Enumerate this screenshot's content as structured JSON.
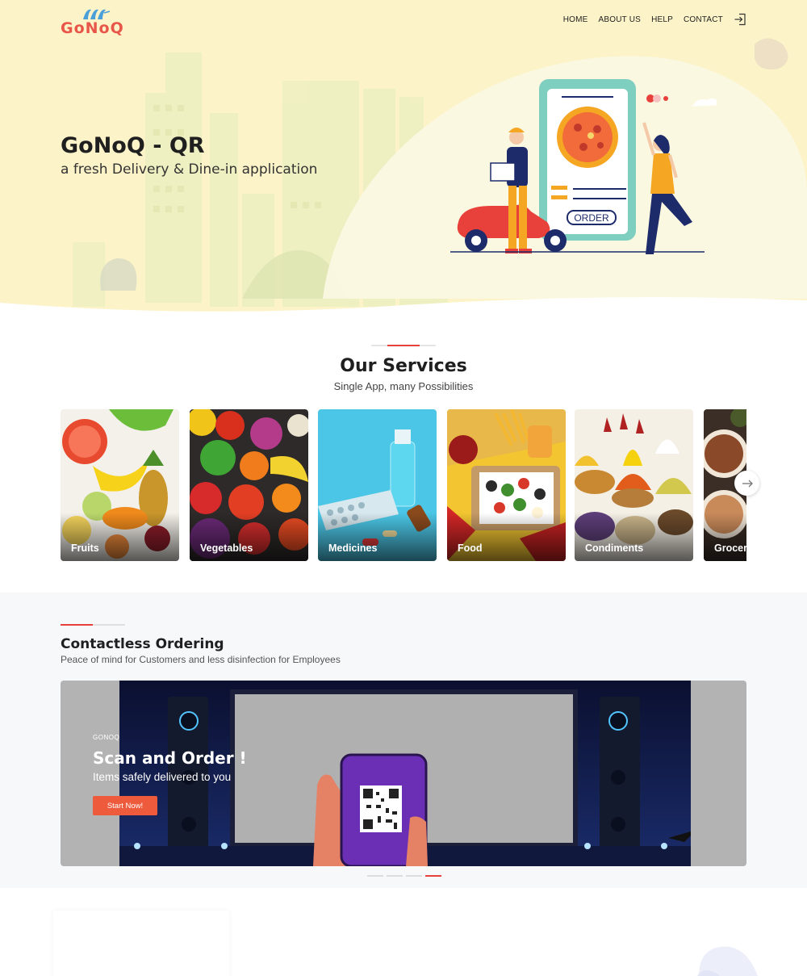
{
  "header": {
    "logo_text": "GoNoQ",
    "nav": [
      "HOME",
      "ABOUT US",
      "HELP",
      "CONTACT"
    ],
    "login_icon": "login-icon"
  },
  "hero": {
    "title": "GoNoQ - QR",
    "subtitle": "a fresh Delivery & Dine-in application",
    "order_label": "ORDER"
  },
  "services": {
    "title": "Our Services",
    "subtitle": "Single App, many Possibilities",
    "cards": [
      {
        "label": "Fruits"
      },
      {
        "label": "Vegetables"
      },
      {
        "label": "Medicines"
      },
      {
        "label": "Food"
      },
      {
        "label": "Condiments"
      },
      {
        "label": "Grocer"
      }
    ],
    "next_icon": "arrow-right-icon"
  },
  "contactless": {
    "title": "Contactless Ordering",
    "subtitle": "Peace of mind for Customers and less disinfection for Employees",
    "slide": {
      "brand": "GONOQ",
      "title": "Scan and Order !",
      "subtitle": "Items safely delivered to you",
      "button": "Start Now!"
    },
    "slide_count": 4,
    "active_slide": 4
  },
  "colors": {
    "accent": "#e8403a",
    "hero_bg": "#fcf3c8",
    "button": "#ee5a3c"
  }
}
